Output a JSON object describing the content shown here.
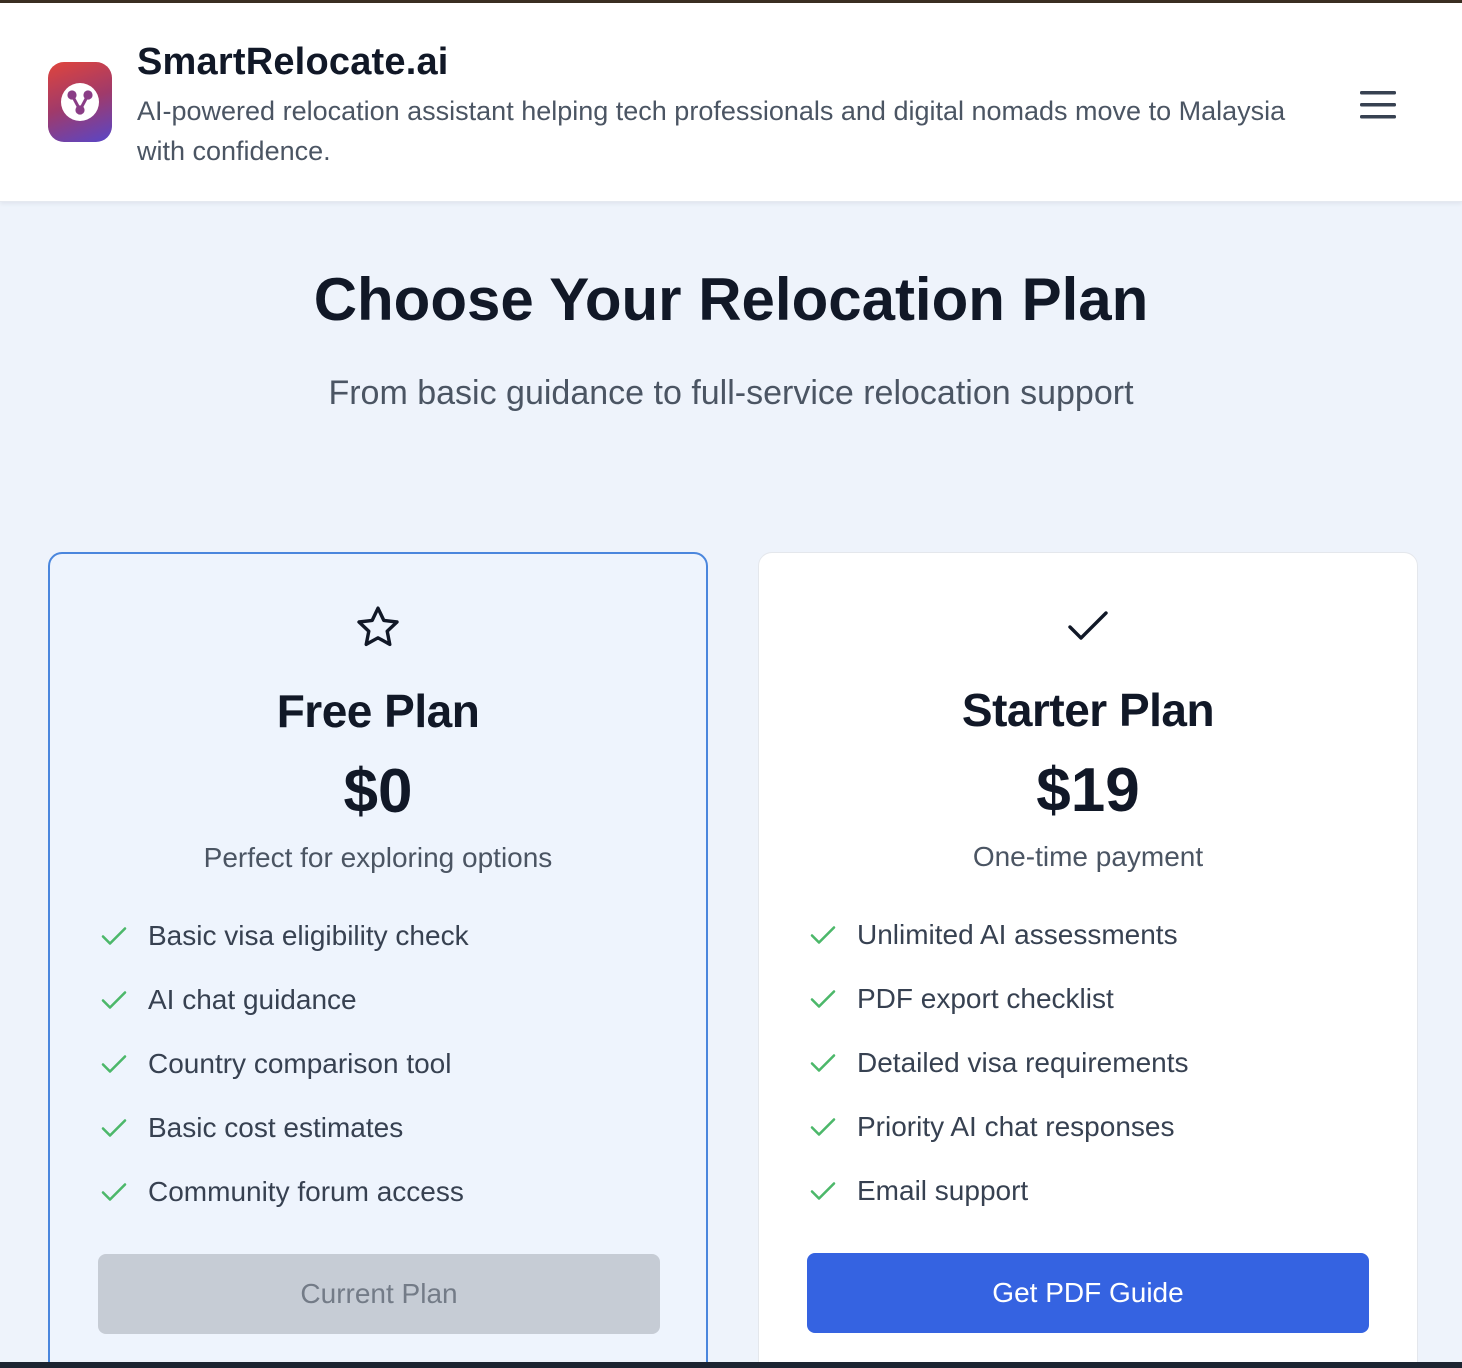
{
  "header": {
    "brand_title": "SmartRelocate.ai",
    "tagline": "AI-powered relocation assistant helping tech professionals and digital nomads move to Malaysia with confidence.",
    "logo_icon": "network-icon",
    "menu_icon": "hamburger-menu-icon"
  },
  "hero": {
    "title": "Choose Your Relocation Plan",
    "subtitle": "From basic guidance to full-service relocation support"
  },
  "plans": [
    {
      "icon": "star-icon",
      "name": "Free Plan",
      "price": "$0",
      "description": "Perfect for exploring options",
      "features": [
        "Basic visa eligibility check",
        "AI chat guidance",
        "Country comparison tool",
        "Basic cost estimates",
        "Community forum access"
      ],
      "button_label": "Current Plan",
      "button_state": "disabled",
      "highlight_color": "#4a86dd"
    },
    {
      "icon": "check-icon",
      "name": "Starter Plan",
      "price": "$19",
      "description": "One-time payment",
      "features": [
        "Unlimited AI assessments",
        "PDF export checklist",
        "Detailed visa requirements",
        "Priority AI chat responses",
        "Email support"
      ],
      "button_label": "Get PDF Guide",
      "button_state": "enabled",
      "button_color": "#3563e1"
    }
  ],
  "colors": {
    "feature_check": "#4cb86a",
    "page_background": "#eef3fb"
  }
}
